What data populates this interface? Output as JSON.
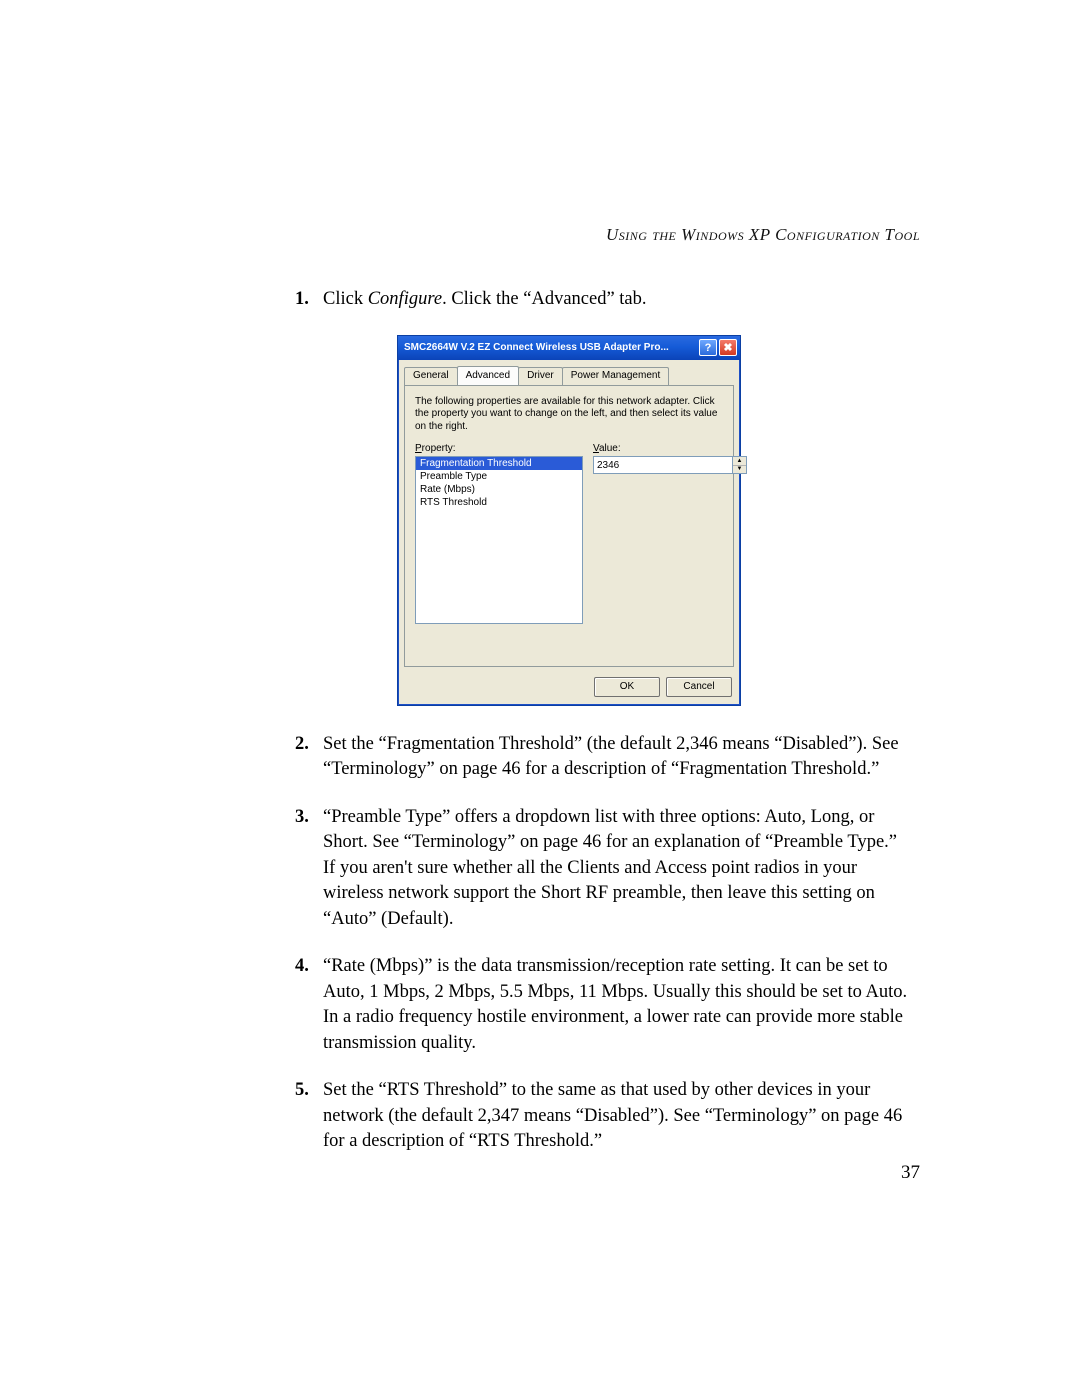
{
  "header": "Using the Windows XP Configuration Tool",
  "page_number": "37",
  "steps": {
    "s1": {
      "num": "1.",
      "pre": "Click ",
      "em": "Configure",
      "post": ". Click the “Advanced” tab."
    },
    "s2": {
      "num": "2.",
      "text": "Set the “Fragmentation Threshold” (the default 2,346 means “Disabled”). See “Terminology” on page 46 for a description of “Fragmentation Threshold.”"
    },
    "s3": {
      "num": "3.",
      "text": "“Preamble Type” offers a dropdown list with three options: Auto, Long, or Short. See “Terminology” on page 46 for an explanation of “Preamble Type.”\nIf you aren't sure whether all the Clients and Access point radios in your wireless network support the Short RF preamble, then leave this setting on “Auto” (Default)."
    },
    "s4": {
      "num": "4.",
      "text": "“Rate (Mbps)” is the data transmission/reception rate setting. It can be set to Auto, 1 Mbps, 2 Mbps, 5.5 Mbps, 11 Mbps. Usually this should be set to Auto.  In a radio frequency hostile environment, a lower rate can provide more stable transmission quality."
    },
    "s5": {
      "num": "5.",
      "text": "Set the “RTS Threshold” to the same as that used by other devices in your network (the default 2,347 means “Disabled”). See “Terminology” on page 46 for a description of “RTS Threshold.”"
    }
  },
  "dialog": {
    "title": "SMC2664W V.2 EZ Connect Wireless USB Adapter Pro...",
    "help_glyph": "?",
    "close_glyph": "✖",
    "tabs": {
      "general": "General",
      "advanced": "Advanced",
      "driver": "Driver",
      "power": "Power Management"
    },
    "description": "The following properties are available for this network adapter. Click the property you want to change on the left, and then select its value on the right.",
    "property_label_u": "P",
    "property_label_rest": "roperty:",
    "value_label_u": "V",
    "value_label_rest": "alue:",
    "properties": {
      "p0": "Fragmentation Threshold",
      "p1": "Preamble Type",
      "p2": "Rate (Mbps)",
      "p3": "RTS Threshold"
    },
    "value": "2346",
    "spin_up": "▲",
    "spin_down": "▼",
    "ok": "OK",
    "cancel": "Cancel"
  }
}
